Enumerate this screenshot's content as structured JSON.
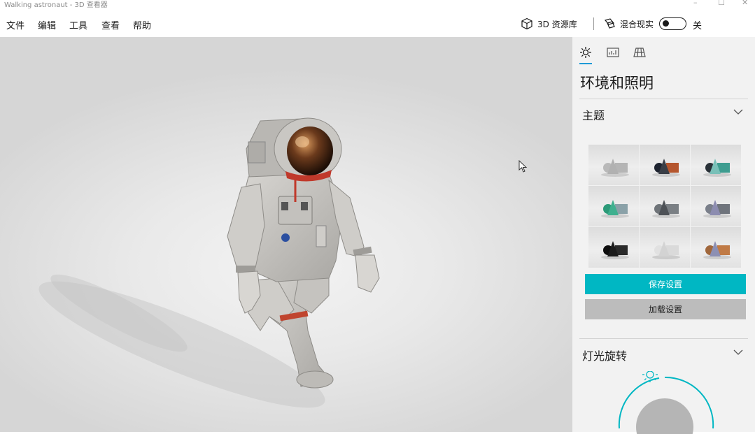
{
  "window": {
    "title": "Walking astronaut - 3D 查看器",
    "minimize": "–",
    "maximize": "☐",
    "close": "✕"
  },
  "menu": {
    "items": [
      "文件",
      "编辑",
      "工具",
      "查看",
      "帮助"
    ]
  },
  "toolbar": {
    "library_label": "3D 资源库",
    "mixed_reality_label": "混合现实",
    "toggle_state_label": "关",
    "toggle_on": false
  },
  "panel": {
    "tabs": [
      "environment-lighting",
      "stats-shading",
      "grid"
    ],
    "active_tab": 0,
    "title": "环境和照明",
    "theme_section": {
      "label": "主题",
      "themes": [
        {
          "name": "neutral-gray",
          "colors": [
            "#b9b9b9",
            "#b1b1b1",
            "#b5b5b5"
          ]
        },
        {
          "name": "dark-warm",
          "colors": [
            "#1e2430",
            "#3a3f47",
            "#b5562e"
          ]
        },
        {
          "name": "teal-dark",
          "colors": [
            "#2a3238",
            "#79c0b8",
            "#3e9d90"
          ]
        },
        {
          "name": "green",
          "colors": [
            "#2c9a78",
            "#3fb08f",
            "#8aa1a8"
          ]
        },
        {
          "name": "slate",
          "colors": [
            "#6f7479",
            "#4e5257",
            "#7a7f84"
          ]
        },
        {
          "name": "lavender",
          "colors": [
            "#7a7f8a",
            "#8c8cb0",
            "#6f747c"
          ]
        },
        {
          "name": "black",
          "colors": [
            "#0f0f0f",
            "#1c1c1c",
            "#2a2a2a"
          ]
        },
        {
          "name": "white",
          "colors": [
            "#e1e1e1",
            "#d3d3d3",
            "#dadada"
          ]
        },
        {
          "name": "copper",
          "colors": [
            "#a0673c",
            "#8c8fb3",
            "#c07a45"
          ]
        }
      ],
      "save_label": "保存设置",
      "load_label": "加载设置"
    },
    "light_section": {
      "label": "灯光旋转"
    }
  },
  "colors": {
    "accent": "#00b7c3",
    "tab_underline": "#1e9ad6"
  }
}
